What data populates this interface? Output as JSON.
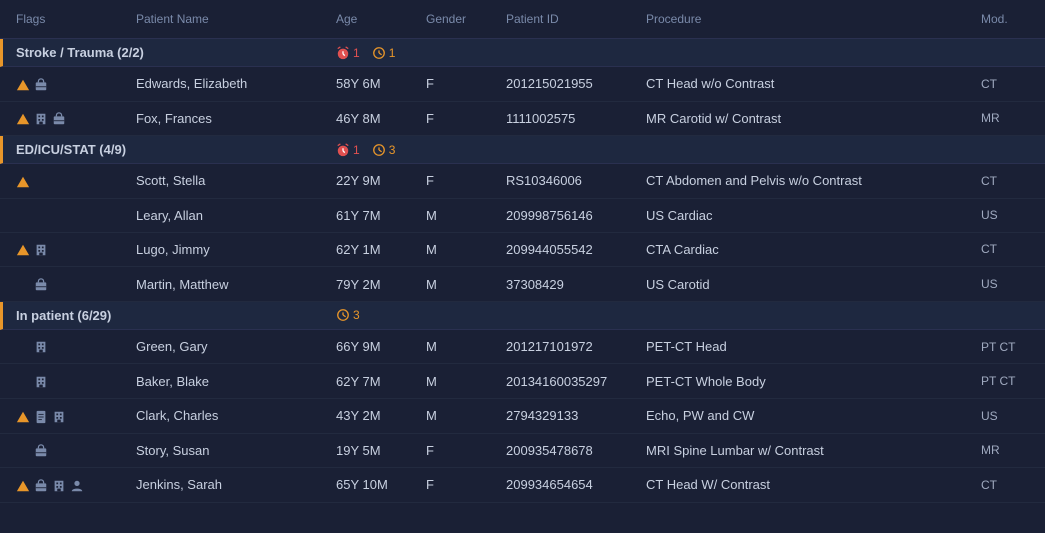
{
  "colors": {
    "background": "#1a2035",
    "groupBg": "#1e2840",
    "rowBg": "#1a2035",
    "rowHover": "#222d45",
    "border": "#2a3050",
    "textPrimary": "#c8d0e0",
    "textSecondary": "#7a8aaa",
    "accentOrange": "#e8962a",
    "accentRed": "#e05050",
    "groupBorderStroke": "#e8962a",
    "groupBorderED": "#e8962a",
    "groupBorderInpatient": "#e8962a"
  },
  "header": {
    "cols": [
      "Flags",
      "Patient Name",
      "Age",
      "Gender",
      "Patient ID",
      "Procedure",
      "Mod."
    ]
  },
  "groups": [
    {
      "label": "Stroke / Trauma (2/2)",
      "badges": [
        {
          "type": "red",
          "icon": "alarm",
          "count": "1"
        },
        {
          "type": "orange",
          "icon": "clock",
          "count": "1"
        }
      ],
      "rows": [
        {
          "flags": [
            "warning"
          ],
          "extraFlags": [
            "briefcase"
          ],
          "name": "Edwards, Elizabeth",
          "age": "58Y 6M",
          "gender": "F",
          "patientId": "201215021955",
          "procedure": "CT Head w/o Contrast",
          "modality": "CT"
        },
        {
          "flags": [
            "warning"
          ],
          "extraFlags": [
            "building",
            "briefcase"
          ],
          "name": "Fox, Frances",
          "age": "46Y 8M",
          "gender": "F",
          "patientId": "1111002575",
          "procedure": "MR Carotid w/ Contrast",
          "modality": "MR"
        }
      ]
    },
    {
      "label": "ED/ICU/STAT (4/9)",
      "badges": [
        {
          "type": "red",
          "icon": "alarm",
          "count": "1"
        },
        {
          "type": "orange",
          "icon": "clock",
          "count": "3"
        }
      ],
      "rows": [
        {
          "flags": [
            "warning"
          ],
          "extraFlags": [],
          "name": "Scott, Stella",
          "age": "22Y 9M",
          "gender": "F",
          "patientId": "RS10346006",
          "procedure": "CT Abdomen and Pelvis w/o Contrast",
          "modality": "CT"
        },
        {
          "flags": [],
          "extraFlags": [],
          "name": "Leary, Allan",
          "age": "61Y 7M",
          "gender": "M",
          "patientId": "209998756146",
          "procedure": "US Cardiac",
          "modality": "US"
        },
        {
          "flags": [
            "warning"
          ],
          "extraFlags": [
            "building"
          ],
          "name": "Lugo, Jimmy",
          "age": "62Y 1M",
          "gender": "M",
          "patientId": "209944055542",
          "procedure": "CTA Cardiac",
          "modality": "CT"
        },
        {
          "flags": [],
          "extraFlags": [
            "briefcase"
          ],
          "name": "Martin, Matthew",
          "age": "79Y 2M",
          "gender": "M",
          "patientId": "37308429",
          "procedure": "US Carotid",
          "modality": "US"
        }
      ]
    },
    {
      "label": "In patient (6/29)",
      "badges": [
        {
          "type": "orange",
          "icon": "clock",
          "count": "3"
        }
      ],
      "rows": [
        {
          "flags": [],
          "extraFlags": [
            "building"
          ],
          "name": "Green, Gary",
          "age": "66Y 9M",
          "gender": "M",
          "patientId": "201217101972",
          "procedure": "PET-CT Head",
          "modality": "PT CT"
        },
        {
          "flags": [],
          "extraFlags": [
            "building"
          ],
          "name": "Baker, Blake",
          "age": "62Y 7M",
          "gender": "M",
          "patientId": "20134160035297",
          "procedure": "PET-CT Whole Body",
          "modality": "PT CT"
        },
        {
          "flags": [
            "warning"
          ],
          "extraFlags": [
            "doc",
            "building"
          ],
          "name": "Clark, Charles",
          "age": "43Y 2M",
          "gender": "M",
          "patientId": "2794329133",
          "procedure": "Echo, PW and CW",
          "modality": "US"
        },
        {
          "flags": [],
          "extraFlags": [
            "briefcase"
          ],
          "name": "Story, Susan",
          "age": "19Y 5M",
          "gender": "F",
          "patientId": "200935478678",
          "procedure": "MRI Spine Lumbar w/ Contrast",
          "modality": "MR"
        },
        {
          "flags": [
            "warning"
          ],
          "extraFlags": [
            "briefcase",
            "building",
            "person"
          ],
          "name": "Jenkins, Sarah",
          "age": "65Y 10M",
          "gender": "F",
          "patientId": "209934654654",
          "procedure": "CT Head W/ Contrast",
          "modality": "CT"
        }
      ]
    }
  ]
}
